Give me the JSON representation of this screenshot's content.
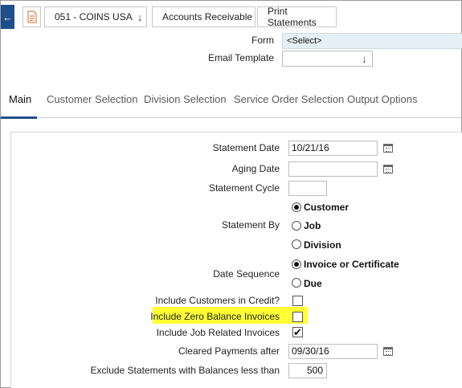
{
  "breadcrumb": {
    "company": "051 - COINS USA",
    "module": "Accounts Receivable",
    "page": "Print Statements"
  },
  "header": {
    "form_label": "Form",
    "form_value": "<Select>",
    "email_template_label": "Email Template",
    "email_template_value": ""
  },
  "tabs": [
    {
      "label": "Main",
      "active": true
    },
    {
      "label": "Customer Selection",
      "active": false
    },
    {
      "label": "Division Selection",
      "active": false
    },
    {
      "label": "Service Order Selection",
      "active": false
    },
    {
      "label": "Output Options",
      "active": false
    }
  ],
  "main": {
    "statement_date": {
      "label": "Statement Date",
      "value": "10/21/16"
    },
    "aging_date": {
      "label": "Aging Date",
      "value": ""
    },
    "statement_cycle": {
      "label": "Statement Cycle",
      "value": ""
    },
    "statement_by": {
      "label": "Statement By",
      "options": [
        "Customer",
        "Job",
        "Division"
      ],
      "selected": "Customer"
    },
    "date_sequence": {
      "label": "Date Sequence",
      "options": [
        "Invoice or Certificate",
        "Due"
      ],
      "selected": "Invoice or Certificate"
    },
    "include_customers_in_credit": {
      "label": "Include Customers in Credit?",
      "checked": false
    },
    "include_zero_balance_invoices": {
      "label": "Include Zero Balance Invoices",
      "checked": false
    },
    "include_job_related_invoices": {
      "label": "Include Job Related Invoices",
      "checked": true
    },
    "cleared_payments_after": {
      "label": "Cleared Payments after",
      "value": "09/30/16"
    },
    "exclude_statements_less_than": {
      "label": "Exclude Statements with Balances less than",
      "value": "500"
    }
  },
  "colors": {
    "accent": "#1f4e8c",
    "highlight": "#ffff33",
    "form_field_bg": "#e6eef6"
  },
  "icons": {
    "back": "arrow-left-icon",
    "document": "document-icon",
    "dropdown": "chevron-down-icon",
    "calendar": "calendar-icon"
  }
}
